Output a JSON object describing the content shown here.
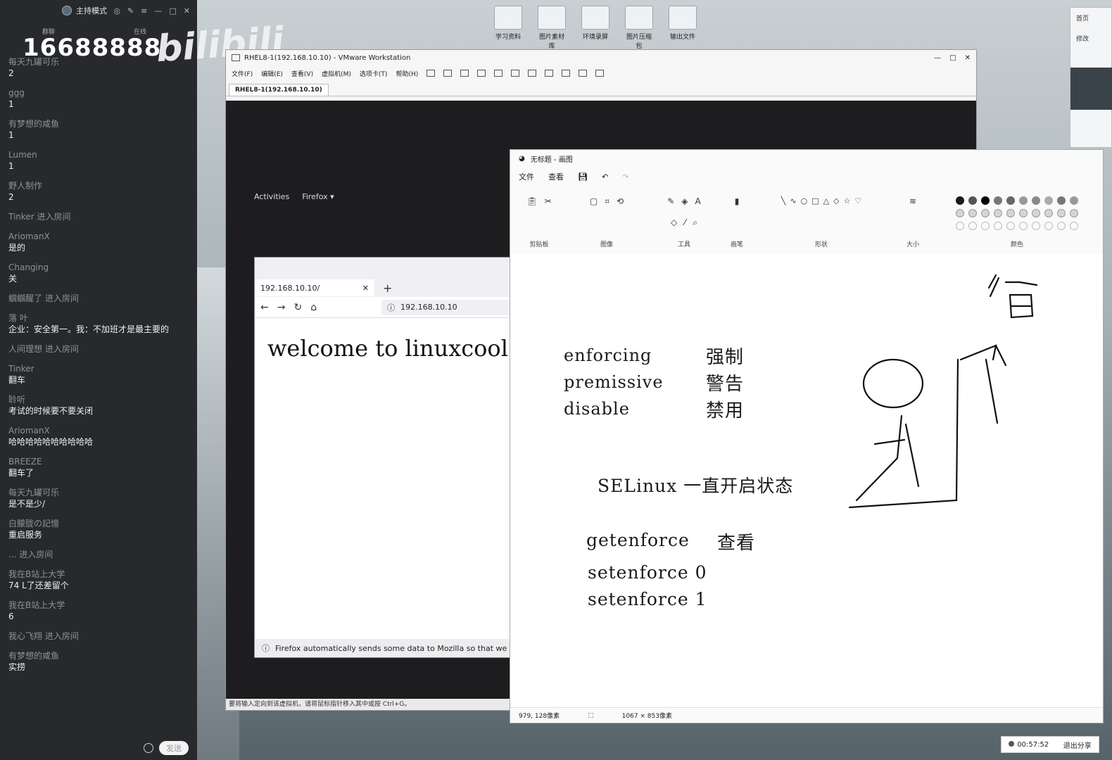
{
  "stream": {
    "mode_label": "主持模式",
    "live_count": "16688888",
    "brand": "bilibili",
    "header_left": "群聊",
    "header_right": "在线",
    "send_label": "发送",
    "messages": [
      {
        "user": "每天九罐可乐",
        "text": "2"
      },
      {
        "user": "ggg",
        "text": "1"
      },
      {
        "user": "有梦想的咸鱼",
        "text": "1"
      },
      {
        "user": "Lumen",
        "text": "1"
      },
      {
        "user": "野人制作",
        "text": "2"
      },
      {
        "user": "Tinker 进入房间",
        "text": ""
      },
      {
        "user": "AriomanX",
        "text": "是的"
      },
      {
        "user": "Changing",
        "text": "关"
      },
      {
        "user": "蝈蝈醒了 进入房间",
        "text": ""
      },
      {
        "user": "落 叶",
        "text": "企业：安全第一。我：不加班才是最主要的"
      },
      {
        "user": "人间理想 进入房间",
        "text": ""
      },
      {
        "user": "Tinker",
        "text": "翻车"
      },
      {
        "user": "聆听",
        "text": "考试的时候要不要关闭"
      },
      {
        "user": "AriomanX",
        "text": "哈哈哈哈哈哈哈哈哈哈"
      },
      {
        "user": "BREEZE",
        "text": "翻车了"
      },
      {
        "user": "每天九罐可乐",
        "text": "是不是少/"
      },
      {
        "user": "白朦胧の記憶",
        "text": "重启服务"
      },
      {
        "user": "... 进入房间",
        "text": ""
      },
      {
        "user": "我在B站上大学",
        "text": "74 L了还差留个"
      },
      {
        "user": "我在B站上大学",
        "text": "6"
      },
      {
        "user": "我心飞翔 进入房间",
        "text": ""
      },
      {
        "user": "有梦想的咸鱼",
        "text": "实捞"
      }
    ]
  },
  "desktop_icons": [
    {
      "label": "学习资料"
    },
    {
      "label": "图片素材库"
    },
    {
      "label": "环境录屏"
    },
    {
      "label": "图片压缩包"
    },
    {
      "label": "输出文件"
    }
  ],
  "right_app": {
    "line1": "首页",
    "line2": "修改"
  },
  "vmware": {
    "title": "RHEL8-1(192.168.10.10) - VMware Workstation",
    "menu": [
      "文件(F)",
      "编辑(E)",
      "查看(V)",
      "虚拟机(M)",
      "选项卡(T)",
      "帮助(H)"
    ],
    "tab": "RHEL8-1(192.168.10.10)",
    "status": "要将输入定向到该虚拟机，请将鼠标指针移入其中或按 Ctrl+G。",
    "win_controls": [
      "—",
      "□",
      "✕"
    ]
  },
  "gnome": {
    "activities": "Activities",
    "app": "Firefox ▾"
  },
  "firefox": {
    "tab_title": "192.168.10.10/",
    "url": "192.168.10.10",
    "page_text": "welcome to linuxcool",
    "notice": "Firefox automatically sends some data to Mozilla so that we can improve your experience."
  },
  "paint": {
    "title": "无标题 - 画图",
    "menu": [
      "文件",
      "查看"
    ],
    "groups": [
      "剪贴板",
      "图像",
      "工具",
      "画笔",
      "形状",
      "大小",
      "颜色"
    ],
    "canvas_text": {
      "l1a": "enforcing",
      "l1b": "强制",
      "l2a": "premissive",
      "l2b": "警告",
      "l3a": "disable",
      "l3b": "禁用",
      "l4": "SELinux 一直开启状态",
      "l5a": "getenforce",
      "l5b": "查看",
      "l6": "setenforce 0",
      "l7": "setenforce 1",
      "hand": "留"
    },
    "status_pos": "979, 128像素",
    "status_size": "1067 × 853像素",
    "colors": [
      "#1a1a1a",
      "#555555",
      "#000000",
      "#777777",
      "#666666",
      "#999999",
      "#888888",
      "#aaaaaa",
      "#777777",
      "#999999"
    ]
  },
  "share": {
    "time": "00:57:52",
    "exit": "退出分享"
  }
}
